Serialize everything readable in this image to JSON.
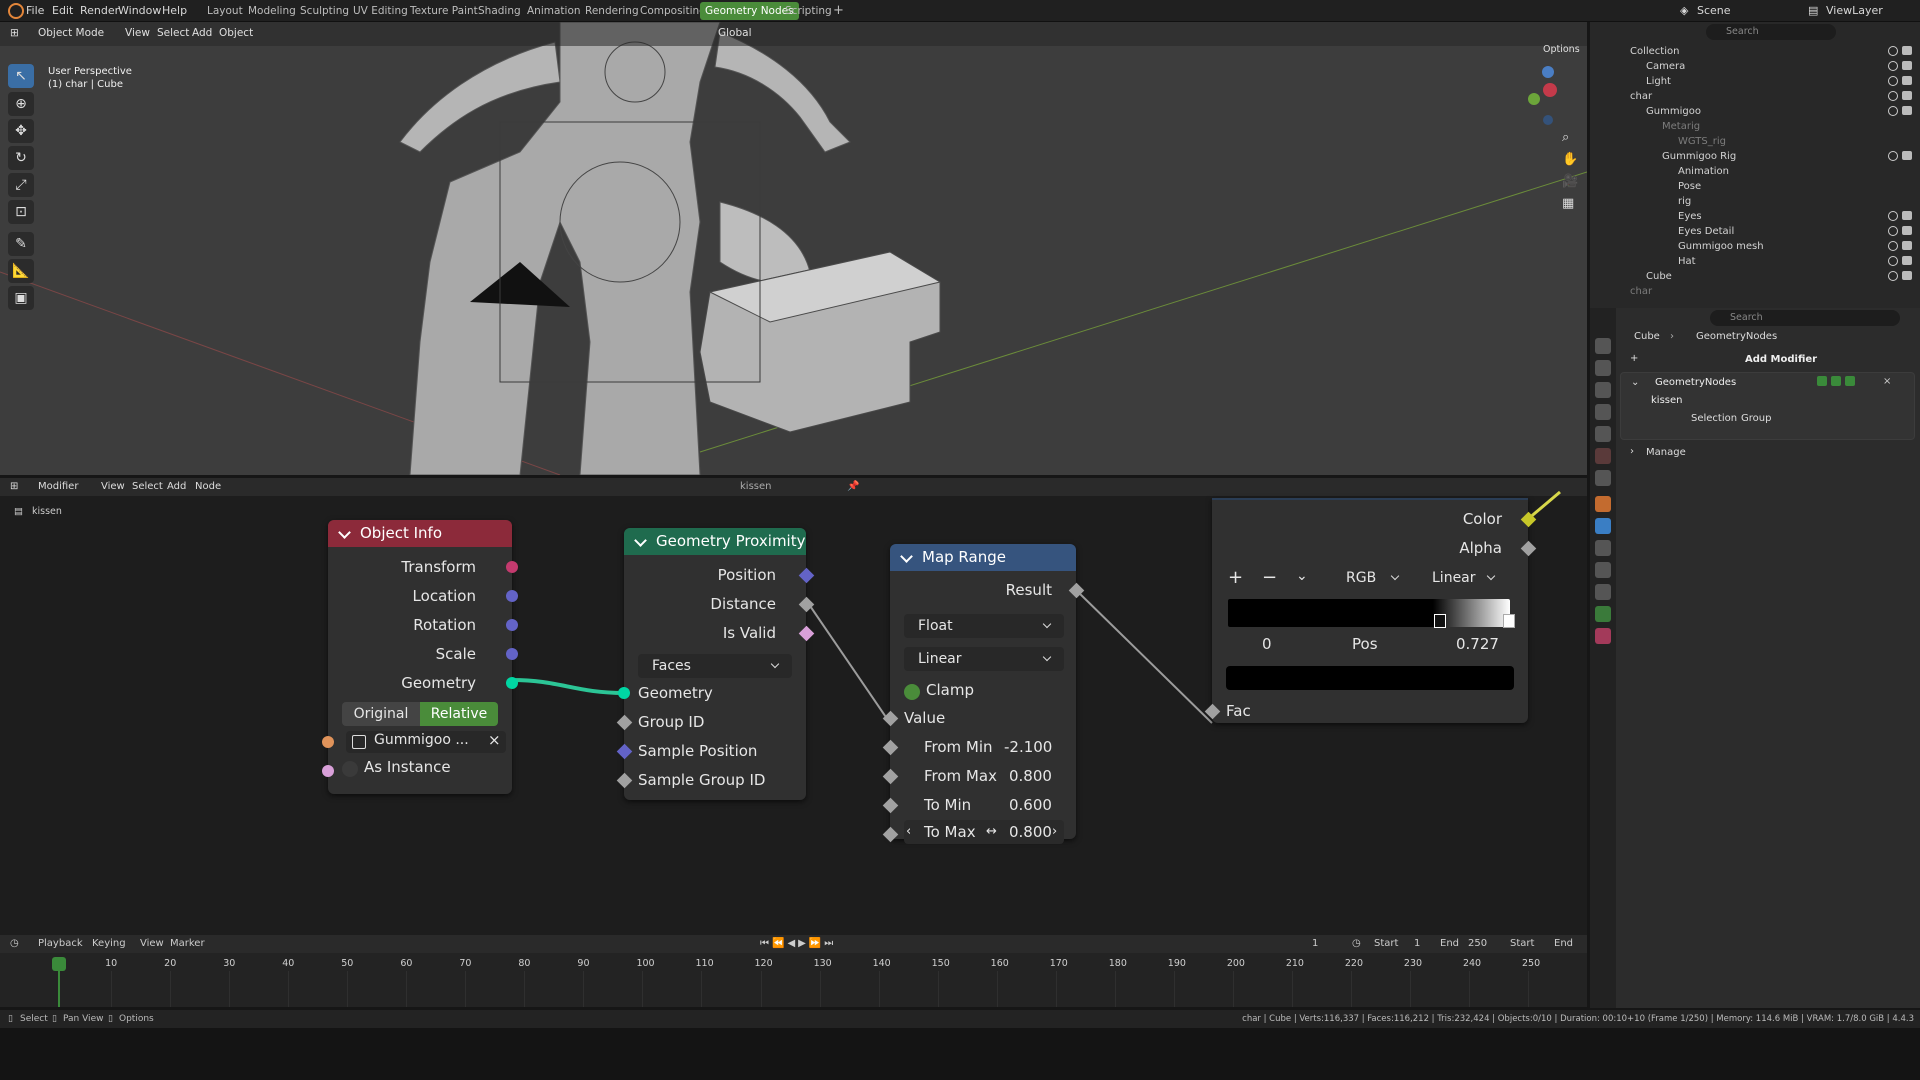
{
  "topbar": {
    "menus": [
      "File",
      "Edit",
      "Render",
      "Window",
      "Help"
    ],
    "workspaces": [
      "Layout",
      "Modeling",
      "Sculpting",
      "UV Editing",
      "Texture Paint",
      "Shading",
      "Animation",
      "Rendering",
      "Compositing",
      "Geometry Nodes",
      "Scripting"
    ],
    "active_workspace": "Geometry Nodes",
    "add_tab": "+",
    "scene": "Scene",
    "view_layer": "ViewLayer"
  },
  "viewport": {
    "mode": "Object Mode",
    "menus": [
      "View",
      "Select",
      "Add",
      "Object"
    ],
    "transform_orientation": "Global",
    "options": "Options",
    "label_perspective": "User Perspective",
    "label_object": "(1) char | Cube"
  },
  "outliner": {
    "search_placeholder": "Search",
    "rows": [
      {
        "label": "Collection",
        "indent": 1
      },
      {
        "label": "Camera",
        "indent": 2
      },
      {
        "label": "Light",
        "indent": 2
      },
      {
        "label": "char",
        "indent": 1
      },
      {
        "label": "Gummigoo",
        "indent": 2
      },
      {
        "label": "Metarig",
        "indent": 3
      },
      {
        "label": "WGTS_rig",
        "indent": 4
      },
      {
        "label": "Gummigoo Rig",
        "indent": 3
      },
      {
        "label": "Animation",
        "indent": 4
      },
      {
        "label": "Pose",
        "indent": 4
      },
      {
        "label": "rig",
        "indent": 4
      },
      {
        "label": "Eyes",
        "indent": 4
      },
      {
        "label": "Eyes Detail",
        "indent": 4
      },
      {
        "label": "Gummigoo mesh",
        "indent": 4
      },
      {
        "label": "Hat",
        "indent": 4
      },
      {
        "label": "Cube",
        "indent": 2
      },
      {
        "label": "char",
        "indent": 1
      }
    ]
  },
  "properties": {
    "search_placeholder": "Search",
    "breadcrumb_object": "Cube",
    "breadcrumb_modifier": "GeometryNodes",
    "add_modifier": "Add Modifier",
    "modifier_name": "GeometryNodes",
    "node_group": "kissen",
    "selection_label": "Selection",
    "group_label": "Group",
    "manage_label": "Manage"
  },
  "node_editor": {
    "editor_type": "Modifier",
    "menus": [
      "View",
      "Select",
      "Add",
      "Node"
    ],
    "group_name": "kissen",
    "breadcrumb": "kissen",
    "object_info": {
      "title": "Object Info",
      "outputs": [
        "Transform",
        "Location",
        "Rotation",
        "Scale",
        "Geometry"
      ],
      "mode_original": "Original",
      "mode_relative": "Relative",
      "object_value": "Gummigoo ...",
      "as_instance": "As Instance"
    },
    "geometry_proximity": {
      "title": "Geometry Proximity",
      "outputs": [
        "Position",
        "Distance",
        "Is Valid"
      ],
      "target_element": "Faces",
      "inputs": [
        "Geometry",
        "Group ID",
        "Sample Position",
        "Sample Group ID"
      ]
    },
    "map_range": {
      "title": "Map Range",
      "output": "Result",
      "data_type": "Float",
      "interpolation": "Linear",
      "clamp": "Clamp",
      "value_label": "Value",
      "from_min_label": "From Min",
      "from_min": "-2.100",
      "from_max_label": "From Max",
      "from_max": "0.800",
      "to_min_label": "To Min",
      "to_min": "0.600",
      "to_max_label": "To Max",
      "to_max": "0.800"
    },
    "color_ramp": {
      "color_label": "Color",
      "alpha_label": "Alpha",
      "add": "+",
      "remove": "−",
      "color_mode": "RGB",
      "interpolation": "Linear",
      "stop_index": "0",
      "pos_label": "Pos",
      "pos_value": "0.727",
      "fac_label": "Fac"
    }
  },
  "timeline": {
    "menus": [
      "Playback",
      "Keying",
      "View",
      "Marker"
    ],
    "current_frame": "1",
    "start_label": "Start",
    "start_value": "1",
    "end_label": "End",
    "end_value": "250",
    "start_btn": "Start",
    "end_btn": "End",
    "ticks": [
      "1",
      "10",
      "20",
      "30",
      "40",
      "50",
      "60",
      "70",
      "80",
      "90",
      "100",
      "110",
      "120",
      "130",
      "140",
      "150",
      "160",
      "170",
      "180",
      "190",
      "200",
      "210",
      "220",
      "230",
      "240",
      "250"
    ]
  },
  "status": {
    "select": "Select",
    "pan_view": "Pan View",
    "options": "Options",
    "stats": "char | Cube | Verts:116,337 | Faces:116,212 | Tris:232,424 | Objects:0/10 | Duration: 00:10+10 (Frame 1/250) | Memory: 114.6 MiB | VRAM: 1.7/8.0 GiB | 4.4.3"
  },
  "colors": {
    "object_info_header": "#8c2a3a",
    "geometry_proximity_header": "#1f6b4e",
    "map_range_header": "#36547e",
    "geometry_socket": "#00d6a3",
    "vector_socket": "#6363c7",
    "float_socket": "#a1a1a1",
    "color_socket": "#c7c729",
    "active_workspace": "#4a8c3a",
    "active_toggle": "#4a8c3a"
  }
}
